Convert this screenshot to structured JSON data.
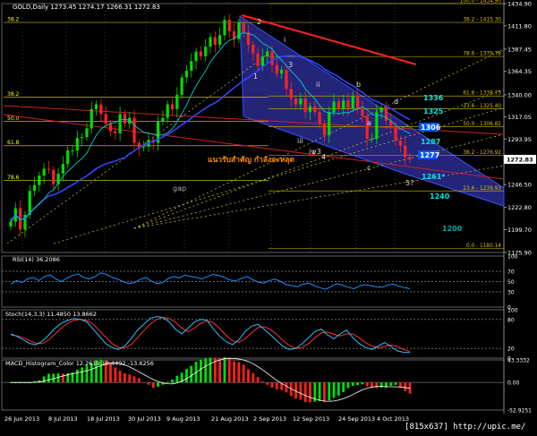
{
  "window": {
    "main_title": "GOLD,Daily  1273.45 1274.17 1266.31 1272.83",
    "watermark": "[815x637] http://upic.me/",
    "thai_note": "แนวรับสำคัญ กำลังจะหลุด",
    "gap_label": "gap",
    "wave_labels": [
      "1",
      "2",
      "3",
      "4",
      "5?",
      "i",
      "ii",
      "iii",
      "iv",
      "v3",
      "a",
      "b",
      "c",
      "d"
    ],
    "target_labels": [
      "1336",
      "1325",
      "1306",
      "1287",
      "1277",
      "1261*",
      "1240",
      "1200"
    ]
  },
  "price_axis": {
    "ticks": [
      "1434.90",
      "1411.80",
      "1387.45",
      "1364.35",
      "1340.00",
      "1317.05",
      "1293.95",
      "1270.85",
      "1246.50",
      "1222.80",
      "1199.70",
      "1175.90"
    ],
    "current": "1272.83"
  },
  "fib_right": [
    {
      "ratio": "100.0",
      "price": "1434.90",
      "label": "100.0 - 1434.90"
    },
    {
      "ratio": "38.2",
      "price": "1415.30",
      "label": "38.2 - 1415.30"
    },
    {
      "ratio": "78.6",
      "price": "1379.78",
      "label": "78.6 - 1379.78"
    },
    {
      "ratio": "61.8",
      "price": "1338.73",
      "label": "61.8 - 1338.73"
    },
    {
      "ratio": "23.6",
      "price": "1325.40",
      "label": "23.6 - 1325.40"
    },
    {
      "ratio": "50.0",
      "price": "1306.82",
      "label": "50.0 - 1306.82"
    },
    {
      "ratio": "38.2",
      "price": "1276.92",
      "label": "38.2 - 1276.92"
    },
    {
      "ratio": "23.6",
      "price": "1239.93",
      "label": "23.6 - 1239.93"
    },
    {
      "ratio": "0.0",
      "price": "1180.14",
      "label": "0.0 - 1180.14"
    }
  ],
  "fib_left": [
    {
      "ratio": "38.2",
      "price": "1415.30"
    },
    {
      "ratio": "38.2",
      "price": "1337.40"
    },
    {
      "ratio": "50.0",
      "price": "1312.30"
    },
    {
      "ratio": "61.8",
      "price": "1287.00"
    },
    {
      "ratio": "78.6",
      "price": "1251.00"
    }
  ],
  "rsi": {
    "label": "RSI(14) 36.2086",
    "ticks": [
      "100",
      "70",
      "50",
      "30",
      "0"
    ]
  },
  "stoch": {
    "label": "Stoch(14,3,3) 11.4850 13.8662",
    "ticks": [
      "100",
      "80",
      "20",
      "0"
    ]
  },
  "macd": {
    "label": "MACD_Histogram_Color 12.2619 18.4492 -13.6256",
    "ticks": [
      "43.3332",
      "0.00",
      "-52.9251"
    ]
  },
  "time_axis": [
    "26 Jun 2013",
    "8 Jul 2013",
    "18 Jul 2013",
    "30 Jul 2013",
    "9 Aug 2013",
    "21 Aug 2013",
    "2 Sep 2013",
    "12 Sep 2013",
    "24 Sep 2013",
    "4 Oct 2013"
  ],
  "chart_data": {
    "type": "candlestick",
    "title": "GOLD,Daily",
    "ylim": [
      1175.9,
      1434.9
    ],
    "x": [
      "26 Jun 2013",
      "8 Jul 2013",
      "18 Jul 2013",
      "30 Jul 2013",
      "9 Aug 2013",
      "21 Aug 2013",
      "2 Sep 2013",
      "12 Sep 2013",
      "24 Sep 2013",
      "4 Oct 2013"
    ],
    "close": [
      1208,
      1222,
      1200,
      1215,
      1240,
      1246,
      1256,
      1263,
      1262,
      1247,
      1258,
      1268,
      1282,
      1282,
      1295,
      1296,
      1305,
      1325,
      1330,
      1320,
      1310,
      1302,
      1300,
      1320,
      1310,
      1316,
      1290,
      1285,
      1286,
      1293,
      1290,
      1312,
      1316,
      1330,
      1325,
      1340,
      1358,
      1365,
      1375,
      1385,
      1380,
      1390,
      1400,
      1392,
      1402,
      1418,
      1406,
      1398,
      1415,
      1405,
      1392,
      1383,
      1370,
      1380,
      1385,
      1371,
      1362,
      1366,
      1346,
      1336,
      1330,
      1336,
      1322,
      1328,
      1322,
      1310,
      1298,
      1322,
      1333,
      1325,
      1334,
      1326,
      1339,
      1326,
      1318,
      1294,
      1294,
      1322,
      1327,
      1313,
      1308,
      1292,
      1287,
      1275,
      1272.83
    ],
    "rsi_values": [
      45,
      52,
      48,
      55,
      58,
      52,
      60,
      63,
      55,
      50,
      57,
      62,
      65,
      58,
      55,
      60,
      67,
      64,
      58,
      55,
      50,
      46,
      48,
      54,
      58,
      51,
      46,
      48,
      56,
      60,
      57,
      63,
      60,
      58,
      55,
      60,
      64,
      62,
      58,
      53,
      51,
      56,
      60,
      54,
      49,
      47,
      52,
      55,
      50,
      44,
      42,
      40,
      45,
      47,
      42,
      38,
      35,
      40,
      46,
      43,
      39,
      36,
      41,
      44,
      42,
      40,
      39,
      43,
      45,
      41,
      38,
      36.2
    ],
    "stoch_k": [
      50,
      45,
      38,
      30,
      28,
      35,
      48,
      62,
      72,
      78,
      82,
      80,
      75,
      60,
      45,
      30,
      22,
      18,
      25,
      40,
      58,
      70,
      82,
      86,
      84,
      75,
      60,
      50,
      62,
      75,
      80,
      78,
      60,
      45,
      34,
      28,
      38,
      55,
      66,
      70,
      60,
      48,
      36,
      24,
      18,
      20,
      30,
      42,
      55,
      60,
      48,
      40,
      50,
      58,
      42,
      30,
      22,
      18,
      25,
      32,
      24,
      15,
      12,
      11.5
    ],
    "stoch_d": [
      48,
      46,
      42,
      36,
      31,
      30,
      38,
      50,
      62,
      72,
      78,
      80,
      78,
      70,
      57,
      43,
      30,
      22,
      21,
      28,
      42,
      57,
      70,
      80,
      84,
      82,
      74,
      62,
      55,
      62,
      72,
      77,
      73,
      61,
      47,
      36,
      33,
      40,
      52,
      63,
      65,
      59,
      49,
      36,
      26,
      20,
      22,
      30,
      42,
      52,
      54,
      49,
      46,
      50,
      50,
      42,
      32,
      25,
      21,
      24,
      27,
      24,
      18,
      13.9
    ]
  }
}
